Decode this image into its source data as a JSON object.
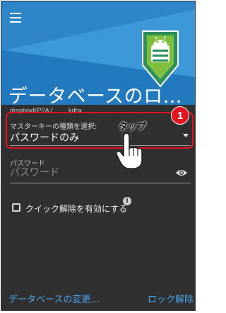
{
  "header": {
    "title": "データベースのロ…",
    "background_watermark": "",
    "accent_color": "#2e86c9"
  },
  "database": {
    "filename": "dropboxKP2A:/.........kdbx"
  },
  "key_type": {
    "label": "マスターキーの種類を選択:",
    "value": "パスワードのみ"
  },
  "annotation": {
    "step_number": "1",
    "tap_label": "タップ",
    "highlight_color": "#e0141e"
  },
  "password": {
    "label": "パスワード",
    "placeholder": "パスワード"
  },
  "quick_unlock": {
    "label": "クイック解除を有効にする",
    "checked": false
  },
  "footer": {
    "change_db": "データベースの変更...",
    "unlock": "ロック解除",
    "link_color": "#4aa6ee"
  },
  "icons": {
    "menu": "menu-icon",
    "logo": "keepass-android-logo",
    "eye": "eye-icon",
    "info": "info-icon",
    "dropdown": "chevron-down-icon",
    "hand": "pointing-hand-icon"
  }
}
